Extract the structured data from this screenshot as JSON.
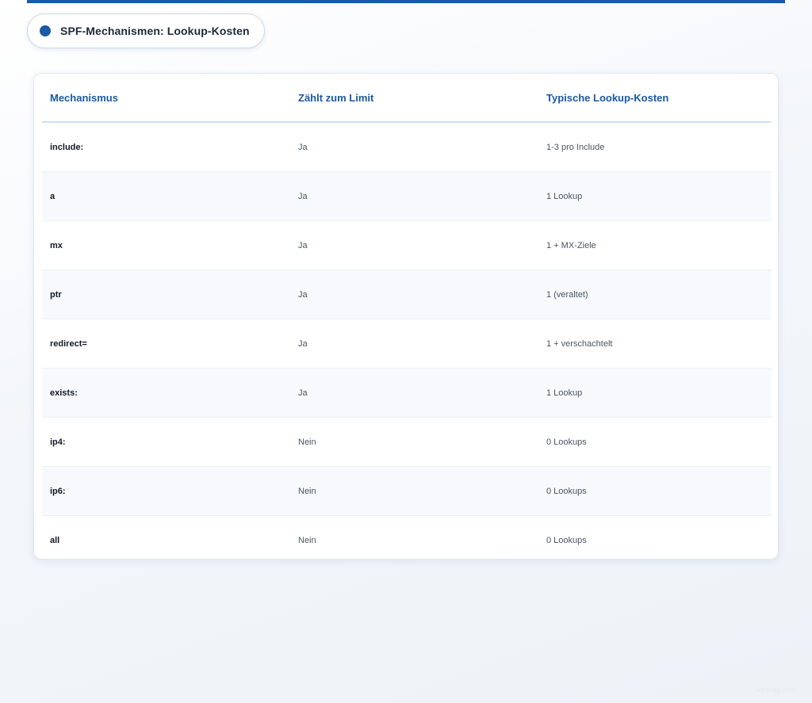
{
  "title": "SPF-Mechanismen: Lookup-Kosten",
  "colors": {
    "accent": "#1a5aa6",
    "header_text": "#1a5aa6",
    "row_alt": "#f7f9fc"
  },
  "table": {
    "headers": [
      "Mechanismus",
      "Zählt zum Limit",
      "Typische Lookup-Kosten"
    ],
    "rows": [
      {
        "mechanism": "include:",
        "counts": "Ja",
        "cost": "1-3 pro Include"
      },
      {
        "mechanism": "a",
        "counts": "Ja",
        "cost": "1 Lookup"
      },
      {
        "mechanism": "mx",
        "counts": "Ja",
        "cost": "1 + MX-Ziele"
      },
      {
        "mechanism": "ptr",
        "counts": "Ja",
        "cost": "1 (veraltet)"
      },
      {
        "mechanism": "redirect=",
        "counts": "Ja",
        "cost": "1 + verschachtelt"
      },
      {
        "mechanism": "exists:",
        "counts": "Ja",
        "cost": "1 Lookup"
      },
      {
        "mechanism": "ip4:",
        "counts": "Nein",
        "cost": "0 Lookups"
      },
      {
        "mechanism": "ip6:",
        "counts": "Nein",
        "cost": "0 Lookups"
      },
      {
        "mechanism": "all",
        "counts": "Nein",
        "cost": "0 Lookups"
      }
    ]
  },
  "watermark": "skysnag.com"
}
